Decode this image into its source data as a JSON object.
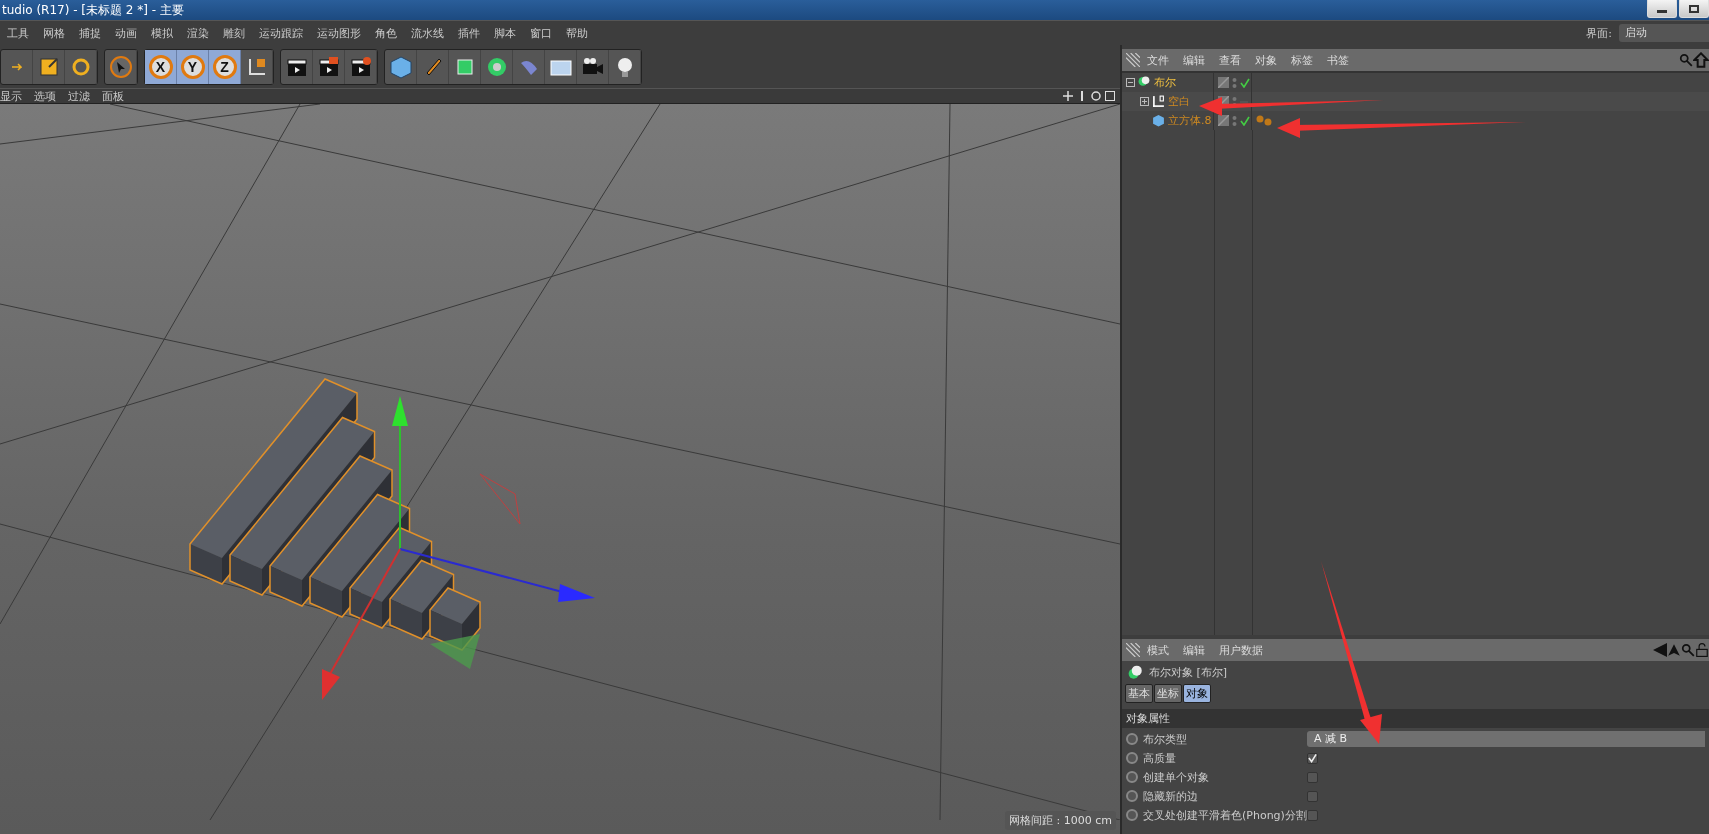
{
  "window": {
    "title": "tudio (R17) - [未标题 2 *] - 主要"
  },
  "menu_bar": {
    "items": [
      "工具",
      "网格",
      "捕捉",
      "动画",
      "模拟",
      "渲染",
      "雕刻",
      "运动跟踪",
      "运动图形",
      "角色",
      "流水线",
      "插件",
      "脚本",
      "窗口",
      "帮助"
    ],
    "layout_label": "界面:",
    "layout_value": "启动"
  },
  "toolbar": {
    "axis_buttons": [
      {
        "label": "X",
        "selected": true
      },
      {
        "label": "Y",
        "selected": true
      },
      {
        "label": "Z",
        "selected": true
      }
    ]
  },
  "viewport": {
    "menu": [
      "显示",
      "选项",
      "过滤",
      "面板"
    ],
    "grid_spacing": "网格间距 : 1000 cm"
  },
  "object_manager": {
    "menu": [
      "文件",
      "编辑",
      "查看",
      "对象",
      "标签",
      "书签"
    ],
    "tree": [
      {
        "name": "布尔",
        "kind": "boole",
        "selected": true,
        "expanded": true,
        "enabled": true,
        "children": [
          {
            "name": "空白",
            "kind": "null",
            "selected": false,
            "expanded": false,
            "enabled": false
          },
          {
            "name": "立方体.8",
            "kind": "cube",
            "selected": false,
            "enabled": true,
            "tags": [
              {
                "kind": "material"
              },
              {
                "kind": "material"
              }
            ]
          }
        ]
      }
    ]
  },
  "attribute_manager": {
    "menu": [
      "模式",
      "编辑",
      "用户数据"
    ],
    "object_title": "布尔对象 [布尔]",
    "tabs": [
      {
        "label": "基本",
        "selected": false
      },
      {
        "label": "坐标",
        "selected": false
      },
      {
        "label": "对象",
        "selected": true
      }
    ],
    "section": "对象属性",
    "fields": [
      {
        "kind": "dropdown",
        "label": "布尔类型",
        "value": "A 减 B"
      },
      {
        "kind": "checkbox",
        "label": "高质量",
        "checked": true
      },
      {
        "kind": "checkbox",
        "label": "创建单个对象",
        "checked": false
      },
      {
        "kind": "checkbox",
        "label": "隐藏新的边",
        "checked": false
      },
      {
        "kind": "checkbox",
        "label": "交叉处创建平滑着色(Phong)分割",
        "checked": false
      }
    ]
  }
}
